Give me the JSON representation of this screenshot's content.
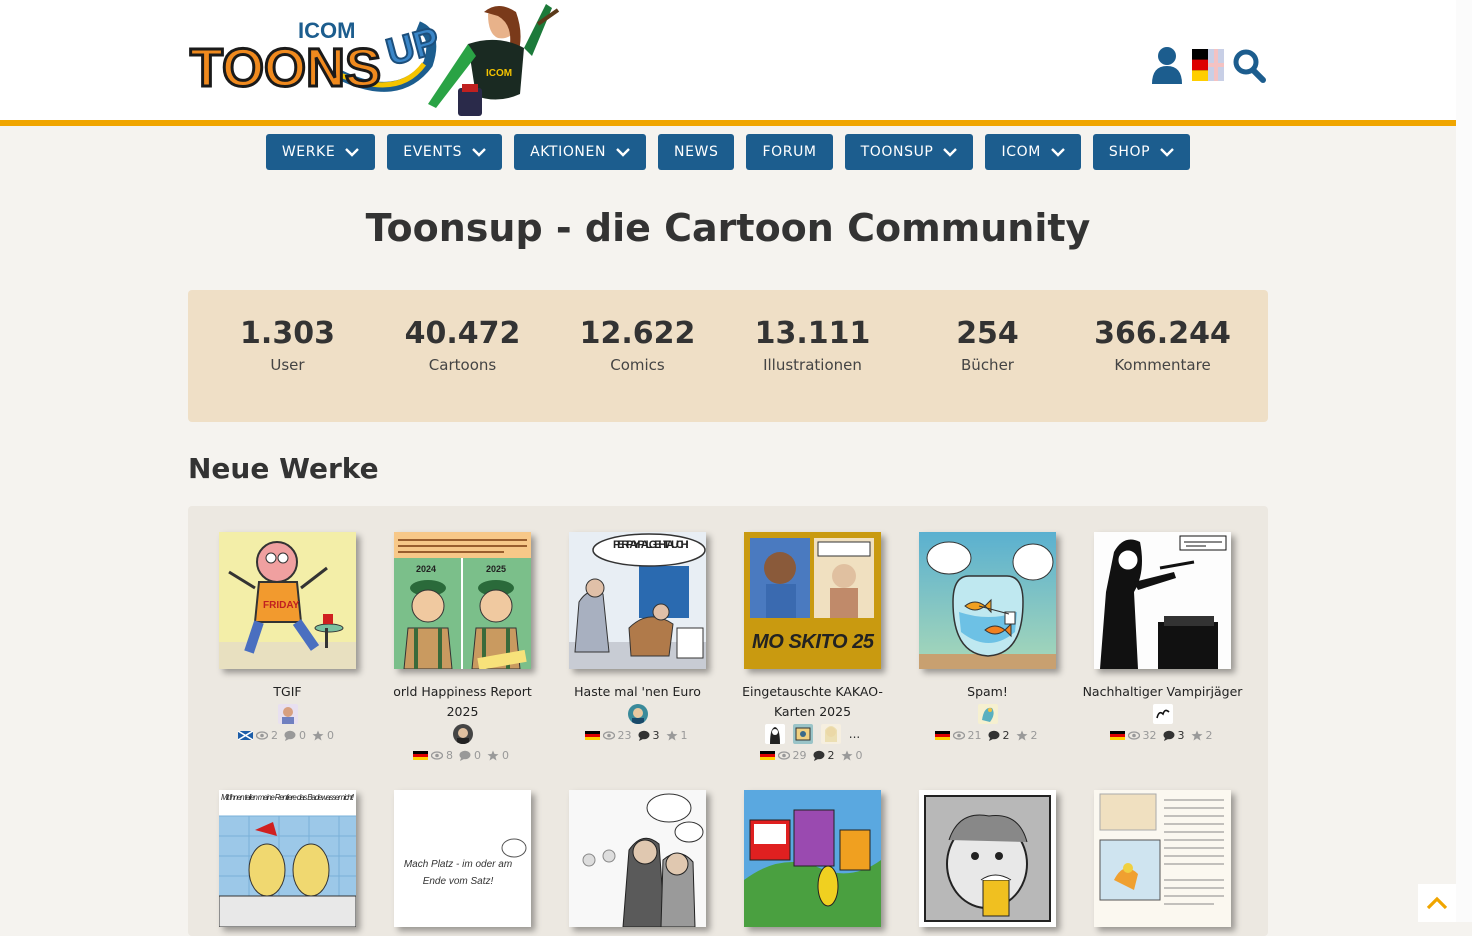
{
  "brand": {
    "logo_top_text": "ICOM",
    "logo_main_text": "TOONS",
    "logo_up_text": "UP"
  },
  "colors": {
    "nav_blue": "#1c5d8e",
    "accent_orange": "#f0a500",
    "stats_bg": "#efdfc6",
    "page_bg": "#f5f3ef"
  },
  "header": {
    "icons": [
      "user-icon",
      "flag-de-en-icon",
      "search-icon"
    ]
  },
  "nav": [
    {
      "label": "WERKE",
      "dropdown": true
    },
    {
      "label": "EVENTS",
      "dropdown": true
    },
    {
      "label": "AKTIONEN",
      "dropdown": true
    },
    {
      "label": "NEWS",
      "dropdown": false
    },
    {
      "label": "FORUM",
      "dropdown": false
    },
    {
      "label": "TOONSUP",
      "dropdown": true
    },
    {
      "label": "ICOM",
      "dropdown": true
    },
    {
      "label": "SHOP",
      "dropdown": true
    }
  ],
  "page_title": "Toonsup - die Cartoon Community",
  "stats": [
    {
      "value": "1.303",
      "label": "User"
    },
    {
      "value": "40.472",
      "label": "Cartoons"
    },
    {
      "value": "12.622",
      "label": "Comics"
    },
    {
      "value": "13.111",
      "label": "Illustrationen"
    },
    {
      "value": "254",
      "label": "Bücher"
    },
    {
      "value": "366.244",
      "label": "Kommentare"
    }
  ],
  "section_title": "Neue Werke",
  "works_row1": [
    {
      "title": "TGIF",
      "flag": "scotland",
      "views": "2",
      "comments": "0",
      "stars": "0",
      "avatars": 1,
      "more": ""
    },
    {
      "title": "orld Happiness Report 2025",
      "flag": "de",
      "views": "8",
      "comments": "0",
      "stars": "0",
      "avatars": 1,
      "more": ""
    },
    {
      "title": "Haste mal 'nen Euro",
      "flag": "de",
      "views": "23",
      "comments": "3",
      "stars": "1",
      "avatars": 1,
      "more": ""
    },
    {
      "title": "Eingetauschte KAKAO-Karten 2025",
      "flag": "de",
      "views": "29",
      "comments": "2",
      "stars": "0",
      "avatars": 3,
      "more": "..."
    },
    {
      "title": "Spam!",
      "flag": "de",
      "views": "21",
      "comments": "2",
      "stars": "2",
      "avatars": 1,
      "more": ""
    },
    {
      "title": "Nachhaltiger Vampirjäger",
      "flag": "de",
      "views": "32",
      "comments": "3",
      "stars": "2",
      "avatars": 1,
      "more": ""
    }
  ],
  "thumb_text": {
    "paypal": "PER PAYPAL GEHT AUCH!",
    "moskito": "MO SKITO 25",
    "friday": "FRIDAY",
    "happiness_years": [
      "2024",
      "2025"
    ],
    "mach_platz": "Mach Platz - im oder am Ende vom Satz!",
    "renntiere": "Mit Ihnen teilen meine Rentiere das Badewasser nicht!"
  }
}
